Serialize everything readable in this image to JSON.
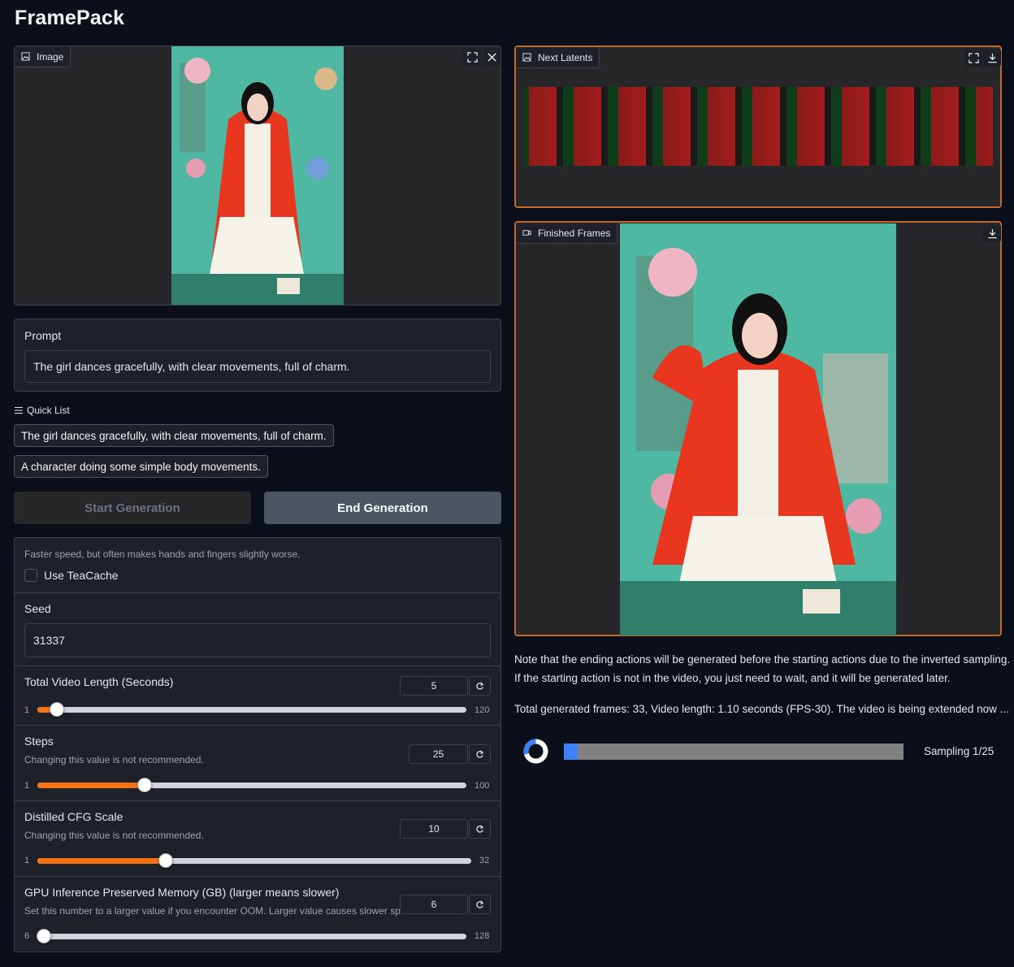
{
  "app": {
    "title": "FramePack"
  },
  "image_input": {
    "label": "Image"
  },
  "prompt": {
    "label": "Prompt",
    "value": "The girl dances gracefully, with clear movements, full of charm."
  },
  "quick_list": {
    "label": "Quick List",
    "items": [
      "The girl dances gracefully, with clear movements, full of charm.",
      "A character doing some simple body movements."
    ]
  },
  "buttons": {
    "start": "Start Generation",
    "end": "End Generation"
  },
  "teacache": {
    "info": "Faster speed, but often makes hands and fingers slightly worse.",
    "label": "Use TeaCache",
    "checked": false
  },
  "seed": {
    "label": "Seed",
    "value": "31337"
  },
  "sliders": {
    "video_length": {
      "label": "Total Video Length (Seconds)",
      "value": "5",
      "min": "1",
      "max": "120"
    },
    "steps": {
      "label": "Steps",
      "info": "Changing this value is not recommended.",
      "value": "25",
      "min": "1",
      "max": "100"
    },
    "cfg": {
      "label": "Distilled CFG Scale",
      "info": "Changing this value is not recommended.",
      "value": "10",
      "min": "1",
      "max": "32"
    },
    "gpu_memory": {
      "label": "GPU Inference Preserved Memory (GB) (larger means slower)",
      "info": "Set this number to a larger value if you encounter OOM. Larger value causes slower speed.",
      "value": "6",
      "min": "6",
      "max": "128"
    }
  },
  "next_latents": {
    "label": "Next Latents"
  },
  "finished_frames": {
    "label": "Finished Frames"
  },
  "notes": {
    "line1": "Note that the ending actions will be generated before the starting actions due to the inverted sampling.",
    "line2": "If the starting action is not in the video, you just need to wait, and it will be generated later.",
    "status": "Total generated frames: 33, Video length: 1.10 seconds (FPS-30). The video is being extended now ..."
  },
  "progress": {
    "label": "Sampling 1/25",
    "fraction": 0.04
  },
  "colors": {
    "accent": "#f97316",
    "progress": "#3b82f6",
    "background": "#0b0f19"
  },
  "icons": [
    "image-icon",
    "fullscreen-icon",
    "close-icon",
    "download-icon",
    "video-icon",
    "list-icon",
    "reset-icon",
    "spinner-icon"
  ]
}
